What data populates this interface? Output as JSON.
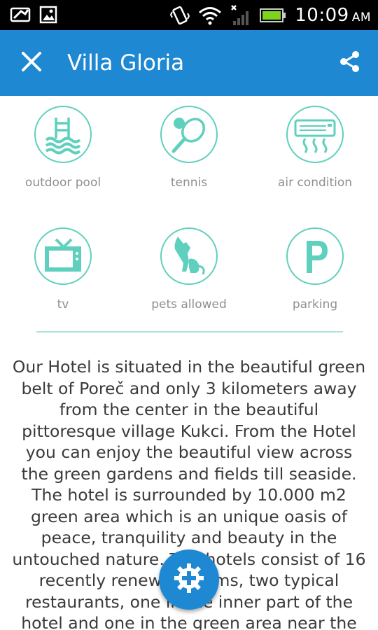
{
  "status_bar": {
    "time": "10:09",
    "ampm": "AM"
  },
  "app_bar": {
    "title": "Villa Gloria",
    "close_icon": "close-icon",
    "share_icon": "share-icon"
  },
  "amenities": [
    {
      "label": "outdoor pool",
      "icon": "pool-icon"
    },
    {
      "label": "tennis",
      "icon": "tennis-icon"
    },
    {
      "label": "air condition",
      "icon": "air-condition-icon"
    },
    {
      "label": "tv",
      "icon": "tv-icon"
    },
    {
      "label": "pets allowed",
      "icon": "pet-icon"
    },
    {
      "label": "parking",
      "icon": "parking-icon"
    }
  ],
  "description": "Our Hotel is situated in the beautiful green belt of Poreč and only 3 kilometers away from the center in the beautiful pittoresque village Kukci. From the Hotel you can enjoy the beautiful view across the green gardens and fields till seaside. The hotel is surrounded by 10.000 m2 green area which is an unique oasis of peace, tranquility and beauty in the untouched nature. The hotels consist of 16 recently renewed rooms, two typical restaurants, one in the inner part of the hotel and one in the green area near the pool, a bar, a",
  "colors": {
    "primary": "#1e88d2",
    "accent": "#5fd0bd",
    "label_gray": "#8f8f8f",
    "text": "#3a3a3a"
  },
  "fab": {
    "icon": "add-gear-icon"
  }
}
